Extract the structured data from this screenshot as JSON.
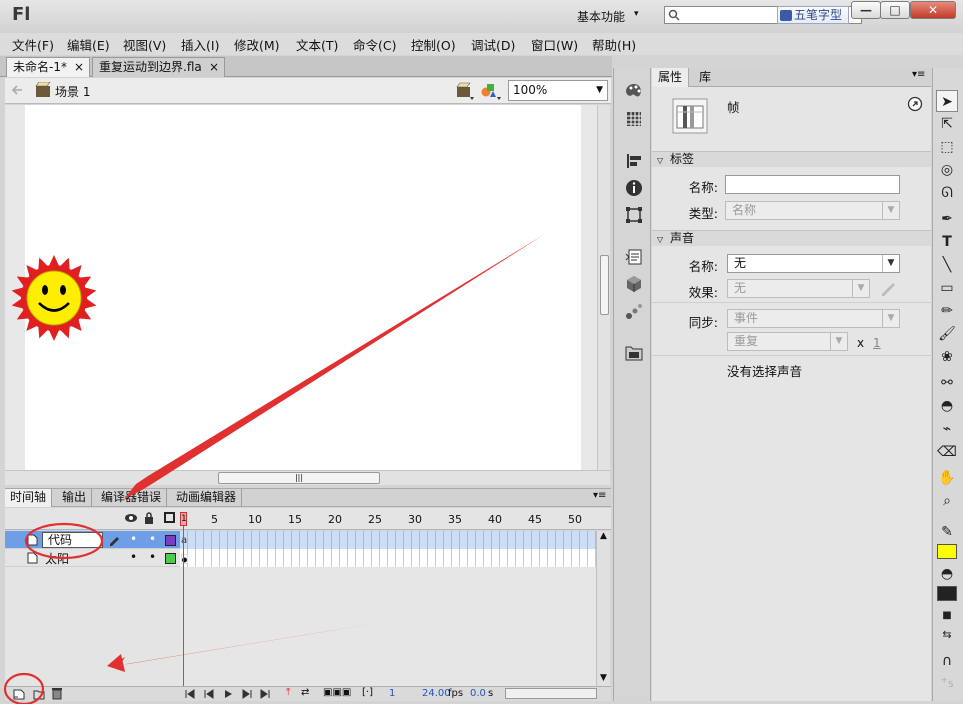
{
  "app": {
    "logo": "Fl",
    "workspace": "基本功能",
    "workspace_arrow": "▾",
    "ime_label": "五笔字型"
  },
  "window_buttons": {
    "minimize": "—",
    "maximize": "□",
    "close": "✕"
  },
  "menu": [
    "文件(F)",
    "编辑(E)",
    "视图(V)",
    "插入(I)",
    "修改(M)",
    "文本(T)",
    "命令(C)",
    "控制(O)",
    "调试(D)",
    "窗口(W)",
    "帮助(H)"
  ],
  "doc_tabs": [
    {
      "label": "未命名-1*",
      "close": "×"
    },
    {
      "label": "重复运动到边界.fla",
      "close": "×"
    }
  ],
  "edit_bar": {
    "scene": "场景 1",
    "zoom": "100%"
  },
  "timeline": {
    "tabs": [
      "时间轴",
      "输出",
      "编译器错误",
      "动画编辑器"
    ],
    "frame_numbers": [
      "1",
      "5",
      "10",
      "15",
      "20",
      "25",
      "30",
      "35",
      "40",
      "45",
      "50"
    ],
    "layers": [
      {
        "name": "代码",
        "color": "#7a3fc0",
        "editing": true
      },
      {
        "name": "太阳",
        "color": "#4ccc4c",
        "editing": false
      }
    ],
    "status": {
      "current_frame": "1",
      "fps": "24.00",
      "fps_unit": "fps",
      "time": "0.0",
      "time_unit": "s"
    }
  },
  "properties": {
    "tabs": [
      "属性",
      "库"
    ],
    "object_type": "帧",
    "label_section": {
      "title": "标签",
      "name_label": "名称:",
      "name_value": "",
      "type_label": "类型:",
      "type_value": "名称"
    },
    "sound_section": {
      "title": "声音",
      "name_label": "名称:",
      "name_value": "无",
      "effect_label": "效果:",
      "effect_value": "无",
      "sync_label": "同步:",
      "sync_value": "事件",
      "repeat_value": "重复",
      "repeat_x": "x",
      "repeat_count": "1",
      "no_sound_text": "没有选择声音"
    }
  },
  "colors": {
    "stroke": "#000000",
    "fill": "#ffff00",
    "accent": "#6e9ee6",
    "annotation": "#e03030"
  }
}
